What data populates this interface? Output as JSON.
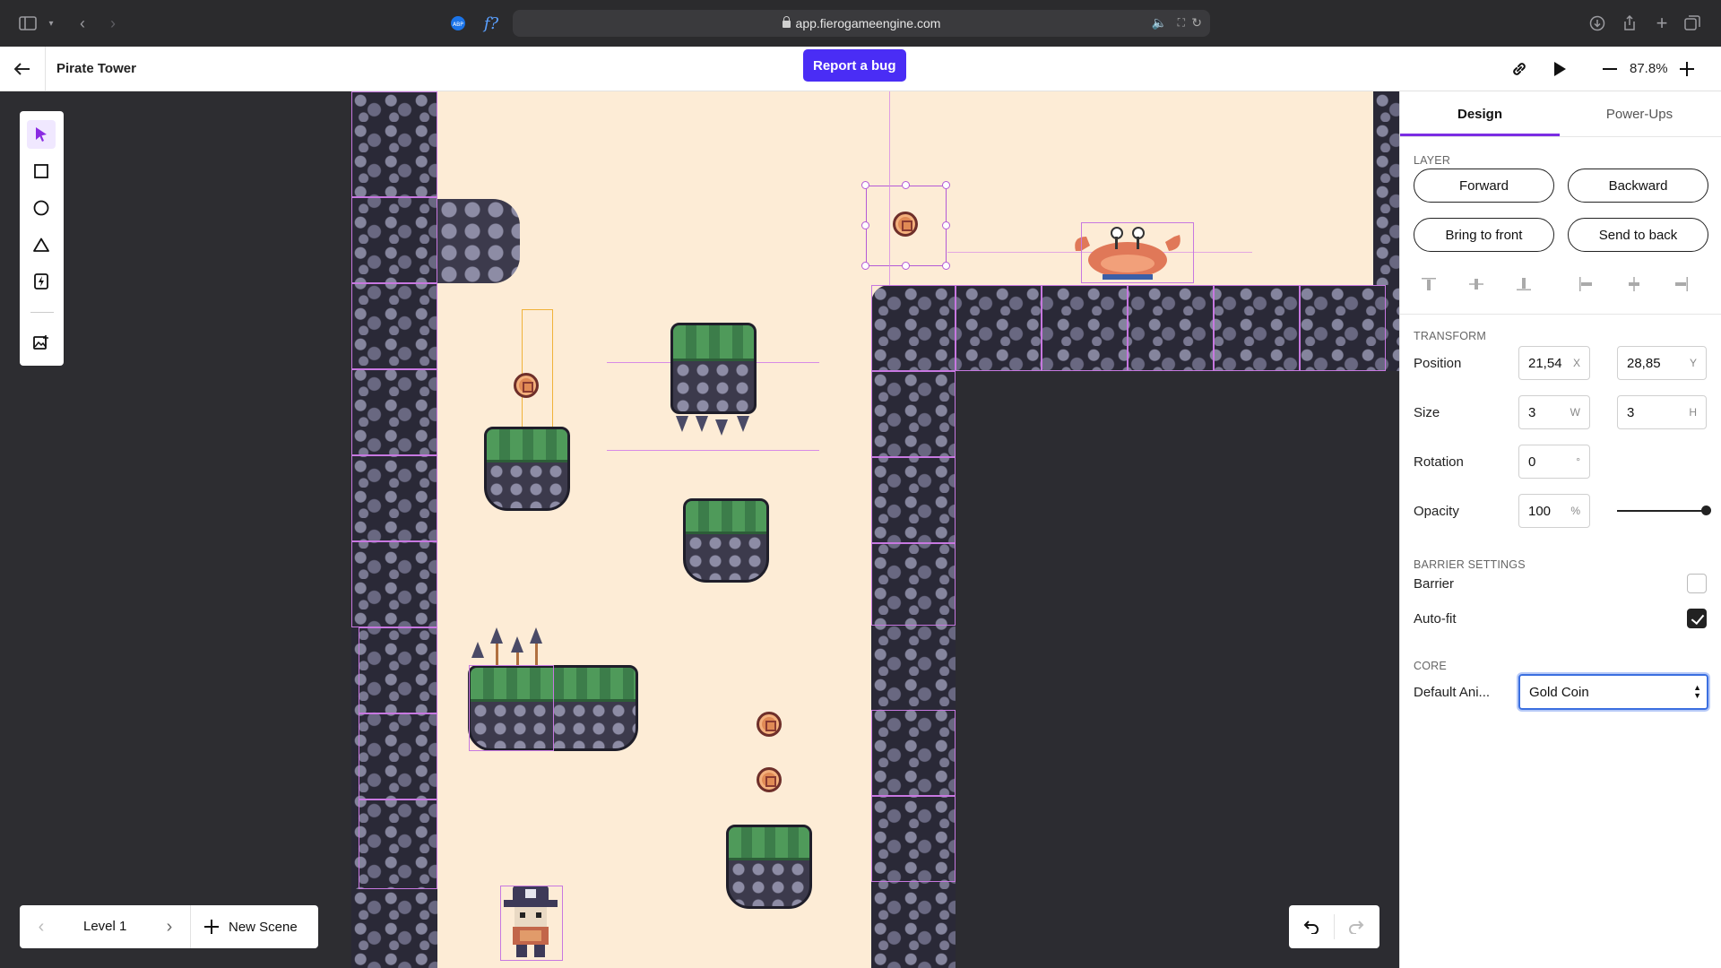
{
  "browser": {
    "url": "app.fierogameengine.com"
  },
  "topbar": {
    "project_title": "Pirate Tower",
    "report_bug_label": "Report a bug",
    "zoom": "87.8%"
  },
  "scene_nav": {
    "current_scene": "Level 1",
    "new_scene_label": "New Scene"
  },
  "panel": {
    "tabs": [
      "Design",
      "Power-Ups"
    ],
    "layer": {
      "title": "LAYER",
      "buttons": [
        "Forward",
        "Backward",
        "Bring to front",
        "Send to back"
      ]
    },
    "transform": {
      "title": "TRANSFORM",
      "position_label": "Position",
      "position_x": "21,54",
      "position_y": "28,85",
      "size_label": "Size",
      "size_w": "3",
      "size_h": "3",
      "rotation_label": "Rotation",
      "rotation": "0",
      "opacity_label": "Opacity",
      "opacity": "100",
      "opacity_level": 1.0,
      "units": {
        "x": "X",
        "y": "Y",
        "w": "W",
        "h": "H",
        "deg": "°",
        "pct": "%"
      }
    },
    "barrier": {
      "title": "BARRIER SETTINGS",
      "barrier_label": "Barrier",
      "barrier_checked": false,
      "autofit_label": "Auto-fit",
      "autofit_checked": true
    },
    "core": {
      "title": "CORE",
      "default_anim_label": "Default Ani...",
      "default_anim_value": "Gold Coin"
    }
  },
  "colors": {
    "accent": "#7b2de3",
    "bug_button": "#4a2df5",
    "canvas_bg": "#fdecd6",
    "focus": "#3b6fe0"
  }
}
